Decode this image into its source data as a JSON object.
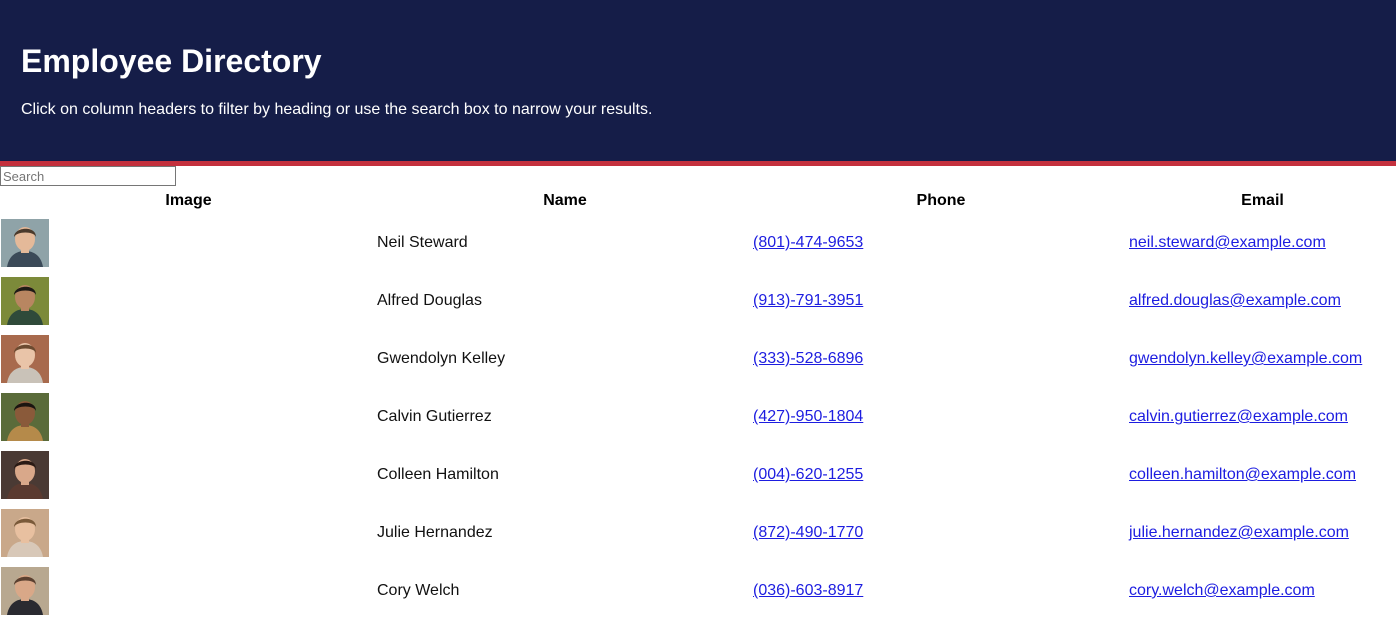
{
  "header": {
    "title": "Employee Directory",
    "subtitle": "Click on column headers to filter by heading or use the search box to narrow your results."
  },
  "colors": {
    "header_bg": "#151d48",
    "divider": "#c4303d",
    "link": "#1d1de0"
  },
  "search": {
    "placeholder": "Search",
    "value": ""
  },
  "table": {
    "columns": [
      "Image",
      "Name",
      "Phone",
      "Email"
    ],
    "rows": [
      {
        "name": "Neil Steward",
        "phone": "(801)-474-9653",
        "email": "neil.steward@example.com",
        "avatar": {
          "bg": "#8fa3a8",
          "skin": "#e4b999",
          "hair": "#4a3a2c",
          "shirt": "#3b4a58"
        }
      },
      {
        "name": "Alfred Douglas",
        "phone": "(913)-791-3951",
        "email": "alfred.douglas@example.com",
        "avatar": {
          "bg": "#7c8a3a",
          "skin": "#b88661",
          "hair": "#1e1a16",
          "shirt": "#2f4a3a"
        }
      },
      {
        "name": "Gwendolyn Kelley",
        "phone": "(333)-528-6896",
        "email": "gwendolyn.kelley@example.com",
        "avatar": {
          "bg": "#a86a4d",
          "skin": "#e9c4a8",
          "hair": "#6b4a30",
          "shirt": "#c9c2b8"
        }
      },
      {
        "name": "Calvin Gutierrez",
        "phone": "(427)-950-1804",
        "email": "calvin.gutierrez@example.com",
        "avatar": {
          "bg": "#5a6b3a",
          "skin": "#8a5a3a",
          "hair": "#1a1410",
          "shirt": "#b58a4a"
        }
      },
      {
        "name": "Colleen Hamilton",
        "phone": "(004)-620-1255",
        "email": "colleen.hamilton@example.com",
        "avatar": {
          "bg": "#4a3a34",
          "skin": "#d9a88a",
          "hair": "#2a1a14",
          "shirt": "#5a3a30"
        }
      },
      {
        "name": "Julie Hernandez",
        "phone": "(872)-490-1770",
        "email": "julie.hernandez@example.com",
        "avatar": {
          "bg": "#c9a88a",
          "skin": "#e8c0a0",
          "hair": "#7a5a3a",
          "shirt": "#d8c8b8"
        }
      },
      {
        "name": "Cory Welch",
        "phone": "(036)-603-8917",
        "email": "cory.welch@example.com",
        "avatar": {
          "bg": "#b8a890",
          "skin": "#d9a888",
          "hair": "#5a4030",
          "shirt": "#2a2a30"
        }
      }
    ]
  }
}
